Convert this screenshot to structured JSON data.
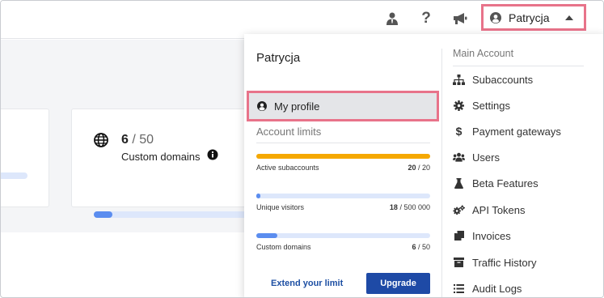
{
  "header": {
    "user_name": "Patrycja",
    "icons": [
      "user-tie-icon",
      "question-icon",
      "megaphone-icon",
      "user-circle-icon",
      "caret-up-icon"
    ]
  },
  "card": {
    "count": "6",
    "total": "/ 50",
    "label": "Custom domains",
    "progress_fraction": 0.12
  },
  "dropdown": {
    "title": "Patrycja",
    "profile_label": "My profile",
    "limits_label": "Account limits",
    "limits": [
      {
        "label": "Active subaccounts",
        "used": "20",
        "total": "/ 20",
        "fraction": 1.0,
        "color": "#f5a800"
      },
      {
        "label": "Unique visitors",
        "used": "18",
        "total": "/ 500 000",
        "fraction": 0.02,
        "color": "#5b8def"
      },
      {
        "label": "Custom domains",
        "used": "6",
        "total": "/ 50",
        "fraction": 0.12,
        "color": "#5b8def"
      }
    ],
    "extend_label": "Extend your limit",
    "upgrade_label": "Upgrade",
    "menu_heading": "Main Account",
    "menu": [
      {
        "label": "Subaccounts",
        "icon": "sitemap-icon"
      },
      {
        "label": "Settings",
        "icon": "gear-icon"
      },
      {
        "label": "Payment gateways",
        "icon": "dollar-icon"
      },
      {
        "label": "Users",
        "icon": "users-icon"
      },
      {
        "label": "Beta Features",
        "icon": "flask-icon"
      },
      {
        "label": "API Tokens",
        "icon": "cogs-icon"
      },
      {
        "label": "Invoices",
        "icon": "copy-icon"
      },
      {
        "label": "Traffic History",
        "icon": "archive-icon"
      },
      {
        "label": "Audit Logs",
        "icon": "list-icon"
      }
    ]
  }
}
